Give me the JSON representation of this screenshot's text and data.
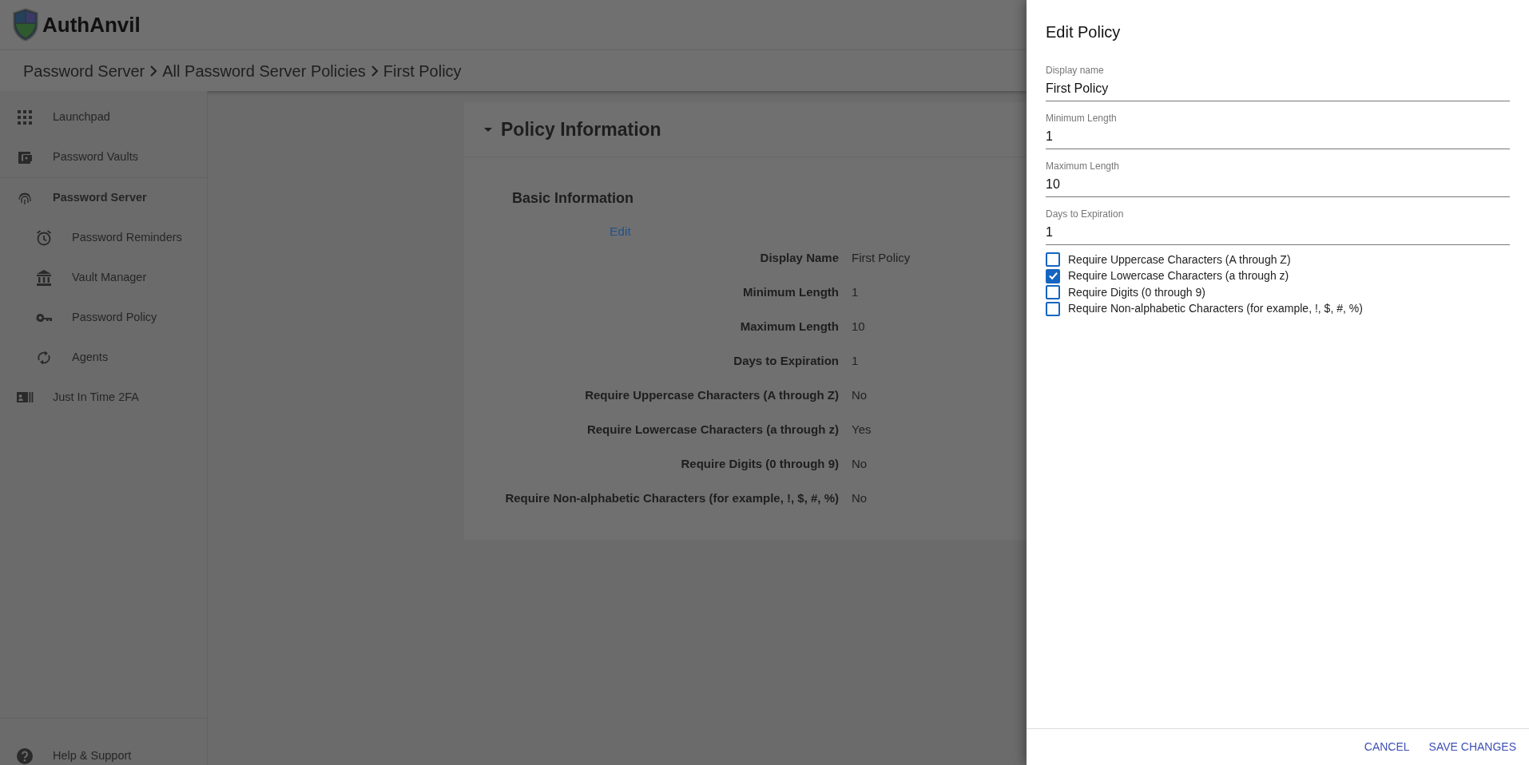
{
  "app": {
    "logo_text": "AuthAnvil"
  },
  "breadcrumb": [
    "Password Server",
    "All Password Server Policies",
    "First Policy"
  ],
  "sidebar": {
    "items": [
      {
        "label": "Launchpad"
      },
      {
        "label": "Password Vaults"
      },
      {
        "label": "Password Server",
        "children": [
          {
            "label": "Password Reminders"
          },
          {
            "label": "Vault Manager"
          },
          {
            "label": "Password Policy"
          },
          {
            "label": "Agents"
          }
        ]
      },
      {
        "label": "Just In Time 2FA"
      }
    ],
    "footer": "Help & Support"
  },
  "policy": {
    "title": "Policy Information",
    "expanded": true,
    "section": "Basic Information",
    "edit_link": "Edit",
    "rows": [
      {
        "label": "Display Name",
        "value": "First Policy"
      },
      {
        "label": "Minimum Length",
        "value": "1"
      },
      {
        "label": "Maximum Length",
        "value": "10"
      },
      {
        "label": "Days to Expiration",
        "value": "1"
      },
      {
        "label": "Require Uppercase Characters (A through Z)",
        "value": "No"
      },
      {
        "label": "Require Lowercase Characters (a through z)",
        "value": "Yes"
      },
      {
        "label": "Require Digits (0 through 9)",
        "value": "No"
      },
      {
        "label": "Require Non-alphabetic Characters (for example, !, $, #, %)",
        "value": "No"
      }
    ]
  },
  "drawer": {
    "title": "Edit Policy",
    "fields": [
      {
        "label": "Display name",
        "value": "First Policy"
      },
      {
        "label": "Minimum Length",
        "value": "1"
      },
      {
        "label": "Maximum Length",
        "value": "10"
      },
      {
        "label": "Days to Expiration",
        "value": "1"
      }
    ],
    "checkboxes": [
      {
        "label": "Require Uppercase Characters (A through Z)",
        "checked": false
      },
      {
        "label": "Require Lowercase Characters (a through z)",
        "checked": true
      },
      {
        "label": "Require Digits (0 through 9)",
        "checked": false
      },
      {
        "label": "Require Non-alphabetic Characters (for example, !, $, #, %)",
        "checked": false
      }
    ],
    "buttons": [
      "CANCEL",
      "SAVE CHANGES"
    ]
  }
}
